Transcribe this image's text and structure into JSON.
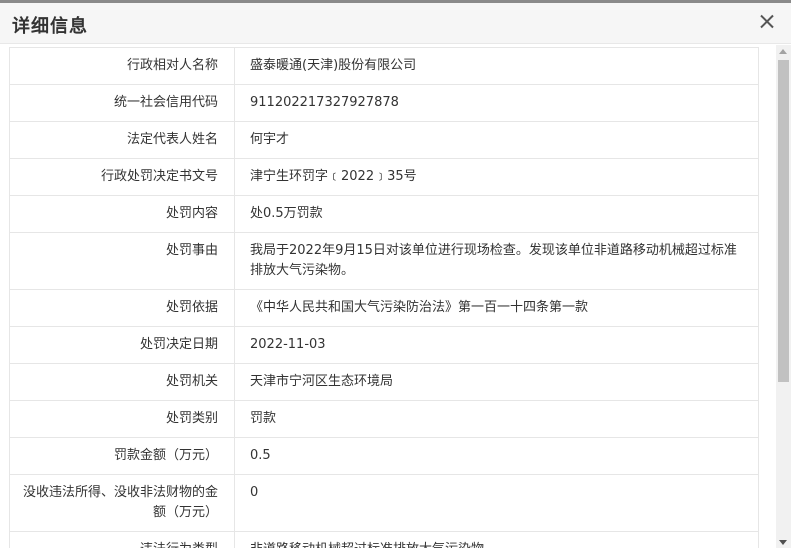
{
  "dialog": {
    "title": "详细信息"
  },
  "rows": [
    {
      "label": "行政相对人名称",
      "value": "盛泰暖通(天津)股份有限公司"
    },
    {
      "label": "统一社会信用代码",
      "value": "911202217327927878"
    },
    {
      "label": "法定代表人姓名",
      "value": "何宇才"
    },
    {
      "label": "行政处罚决定书文号",
      "value": "津宁生环罚字﹝2022﹞35号"
    },
    {
      "label": "处罚内容",
      "value": "处0.5万罚款"
    },
    {
      "label": "处罚事由",
      "value": "我局于2022年9月15日对该单位进行现场检查。发现该单位非道路移动机械超过标准排放大气污染物。"
    },
    {
      "label": "处罚依据",
      "value": "《中华人民共和国大气污染防治法》第一百一十四条第一款"
    },
    {
      "label": "处罚决定日期",
      "value": "2022-11-03"
    },
    {
      "label": "处罚机关",
      "value": "天津市宁河区生态环境局"
    },
    {
      "label": "处罚类别",
      "value": "罚款"
    },
    {
      "label": "罚款金额（万元）",
      "value": "0.5"
    },
    {
      "label": "没收违法所得、没收非法财物的金额（万元）",
      "value": "0"
    },
    {
      "label": "违法行为类型",
      "value": "非道路移动机械超过标准排放大气污染物"
    }
  ]
}
